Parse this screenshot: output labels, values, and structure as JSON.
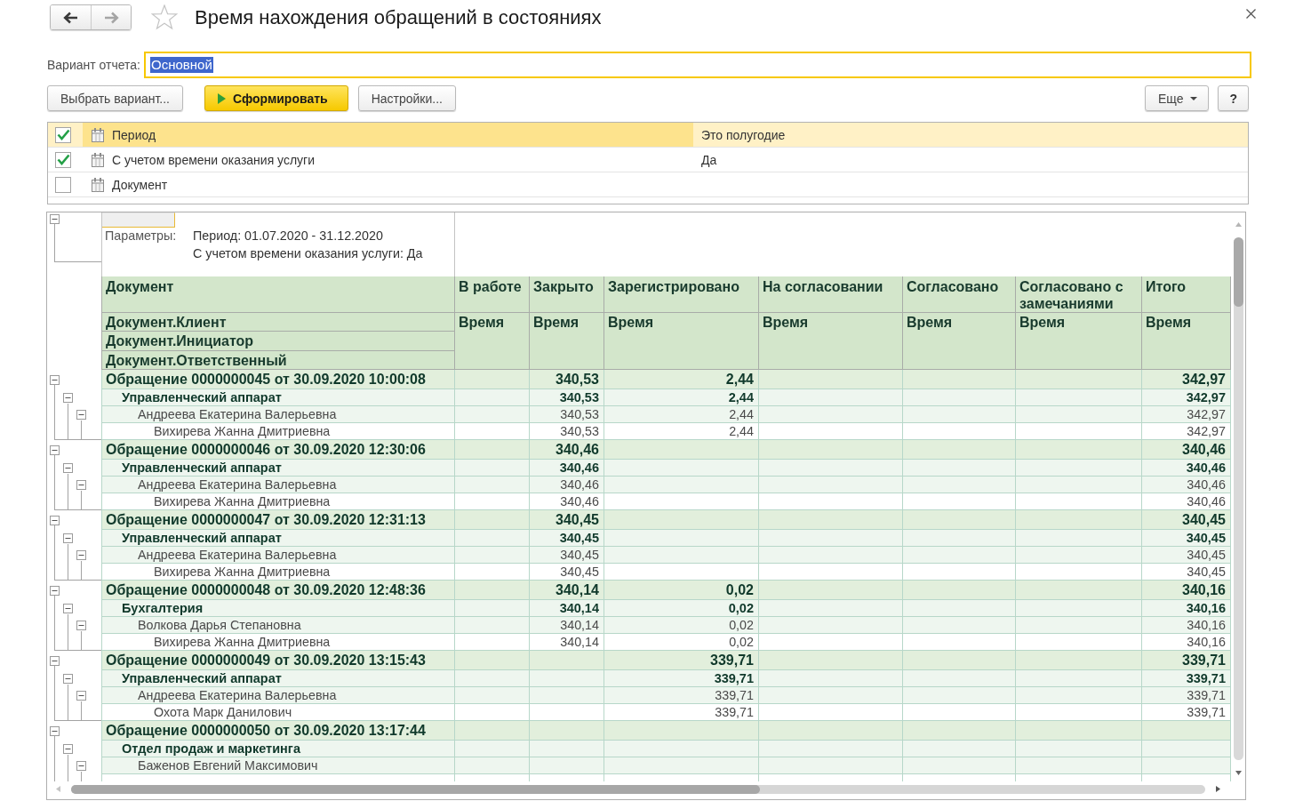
{
  "window": {
    "title": "Время нахождения обращений в состояниях",
    "favorite": false
  },
  "navigation": {
    "back": {
      "disabled": false
    },
    "forward": {
      "disabled": true
    }
  },
  "report_variant": {
    "label": "Вариант отчета:",
    "value": "Основной",
    "focused": true
  },
  "command_bar": {
    "buttons": [
      {
        "kind": "plain",
        "label": "Выбрать вариант..."
      },
      {
        "kind": "primary",
        "label": "Сформировать"
      },
      {
        "kind": "plain",
        "label": "Настройки..."
      }
    ],
    "right_buttons": [
      {
        "kind": "menu",
        "label": "Еще"
      },
      {
        "kind": "help",
        "label": "?"
      }
    ]
  },
  "settings": [
    {
      "label": "Период",
      "value": "Это полугодие",
      "checked": true,
      "selected": true
    },
    {
      "label": "С учетом времени оказания услуги",
      "value": "Да",
      "checked": true,
      "selected": false
    },
    {
      "label": "Документ",
      "checked": false,
      "selected": false
    }
  ],
  "report": {
    "header": {
      "expanded": true,
      "title_cell": {
        "selected": true
      },
      "parameters_label": "Параметры:",
      "parameters": [
        "Период: 01.07.2020 - 31.12.2020",
        "С учетом времени оказания услуги: Да"
      ]
    },
    "columns": [
      {
        "title": "Документ",
        "subtitles": [
          "Документ.Клиент",
          "Документ.Инициатор",
          "Документ.Ответственный"
        ]
      },
      {
        "title": "В работе",
        "subtitles": [
          "Время"
        ]
      },
      {
        "title": "Закрыто",
        "subtitles": [
          "Время"
        ]
      },
      {
        "title": "Зарегистрировано",
        "subtitles": [
          "Время"
        ]
      },
      {
        "title": "На согласовании",
        "subtitles": [
          "Время"
        ]
      },
      {
        "title": "Согласовано",
        "subtitles": [
          "Время"
        ]
      },
      {
        "title": "Согласовано с замечаниями",
        "subtitles": [
          "Время"
        ]
      },
      {
        "title": "Итого",
        "subtitles": [
          "Время"
        ]
      }
    ],
    "rows": [
      {
        "label": "Обращение 0000000045 от 30.09.2020 10:00:08",
        "cells": [
          {
            "kind": "blank"
          },
          {
            "kind": "number",
            "text": "340,53"
          },
          {
            "kind": "number",
            "text": "2,44"
          },
          {
            "kind": "blank"
          },
          {
            "kind": "blank"
          },
          {
            "kind": "blank"
          },
          {
            "kind": "number",
            "text": "342,97"
          }
        ],
        "expanded": true,
        "children": [
          {
            "label": "Управленческий аппарат",
            "cells": [
              {
                "kind": "blank"
              },
              {
                "kind": "number",
                "text": "340,53"
              },
              {
                "kind": "number",
                "text": "2,44"
              },
              {
                "kind": "blank"
              },
              {
                "kind": "blank"
              },
              {
                "kind": "blank"
              },
              {
                "kind": "number",
                "text": "342,97"
              }
            ],
            "expanded": true,
            "children": [
              {
                "label": "Андреева Екатерина Валерьевна",
                "cells": [
                  {
                    "kind": "blank"
                  },
                  {
                    "kind": "number",
                    "text": "340,53"
                  },
                  {
                    "kind": "number",
                    "text": "2,44"
                  },
                  {
                    "kind": "blank"
                  },
                  {
                    "kind": "blank"
                  },
                  {
                    "kind": "blank"
                  },
                  {
                    "kind": "number",
                    "text": "342,97"
                  }
                ],
                "expanded": true,
                "children": [
                  {
                    "label": "Вихирева Жанна Дмитриевна",
                    "cells": [
                      {
                        "kind": "blank"
                      },
                      {
                        "kind": "number",
                        "text": "340,53"
                      },
                      {
                        "kind": "number",
                        "text": "2,44"
                      },
                      {
                        "kind": "blank"
                      },
                      {
                        "kind": "blank"
                      },
                      {
                        "kind": "blank"
                      },
                      {
                        "kind": "number",
                        "text": "342,97"
                      }
                    ]
                  }
                ]
              }
            ]
          }
        ]
      },
      {
        "label": "Обращение 0000000046 от 30.09.2020 12:30:06",
        "cells": [
          {
            "kind": "blank"
          },
          {
            "kind": "number",
            "text": "340,46"
          },
          {
            "kind": "blank"
          },
          {
            "kind": "blank"
          },
          {
            "kind": "blank"
          },
          {
            "kind": "blank"
          },
          {
            "kind": "number",
            "text": "340,46"
          }
        ],
        "expanded": true,
        "children": [
          {
            "label": "Управленческий аппарат",
            "cells": [
              {
                "kind": "blank"
              },
              {
                "kind": "number",
                "text": "340,46"
              },
              {
                "kind": "blank"
              },
              {
                "kind": "blank"
              },
              {
                "kind": "blank"
              },
              {
                "kind": "blank"
              },
              {
                "kind": "number",
                "text": "340,46"
              }
            ],
            "expanded": true,
            "children": [
              {
                "label": "Андреева Екатерина Валерьевна",
                "cells": [
                  {
                    "kind": "blank"
                  },
                  {
                    "kind": "number",
                    "text": "340,46"
                  },
                  {
                    "kind": "blank"
                  },
                  {
                    "kind": "blank"
                  },
                  {
                    "kind": "blank"
                  },
                  {
                    "kind": "blank"
                  },
                  {
                    "kind": "number",
                    "text": "340,46"
                  }
                ],
                "expanded": true,
                "children": [
                  {
                    "label": "Вихирева Жанна Дмитриевна",
                    "cells": [
                      {
                        "kind": "blank"
                      },
                      {
                        "kind": "number",
                        "text": "340,46"
                      },
                      {
                        "kind": "blank"
                      },
                      {
                        "kind": "blank"
                      },
                      {
                        "kind": "blank"
                      },
                      {
                        "kind": "blank"
                      },
                      {
                        "kind": "number",
                        "text": "340,46"
                      }
                    ]
                  }
                ]
              }
            ]
          }
        ]
      },
      {
        "label": "Обращение 0000000047 от 30.09.2020 12:31:13",
        "cells": [
          {
            "kind": "blank"
          },
          {
            "kind": "number",
            "text": "340,45"
          },
          {
            "kind": "blank"
          },
          {
            "kind": "blank"
          },
          {
            "kind": "blank"
          },
          {
            "kind": "blank"
          },
          {
            "kind": "number",
            "text": "340,45"
          }
        ],
        "expanded": true,
        "children": [
          {
            "label": "Управленческий аппарат",
            "cells": [
              {
                "kind": "blank"
              },
              {
                "kind": "number",
                "text": "340,45"
              },
              {
                "kind": "blank"
              },
              {
                "kind": "blank"
              },
              {
                "kind": "blank"
              },
              {
                "kind": "blank"
              },
              {
                "kind": "number",
                "text": "340,45"
              }
            ],
            "expanded": true,
            "children": [
              {
                "label": "Андреева Екатерина Валерьевна",
                "cells": [
                  {
                    "kind": "blank"
                  },
                  {
                    "kind": "number",
                    "text": "340,45"
                  },
                  {
                    "kind": "blank"
                  },
                  {
                    "kind": "blank"
                  },
                  {
                    "kind": "blank"
                  },
                  {
                    "kind": "blank"
                  },
                  {
                    "kind": "number",
                    "text": "340,45"
                  }
                ],
                "expanded": true,
                "children": [
                  {
                    "label": "Вихирева Жанна Дмитриевна",
                    "cells": [
                      {
                        "kind": "blank"
                      },
                      {
                        "kind": "number",
                        "text": "340,45"
                      },
                      {
                        "kind": "blank"
                      },
                      {
                        "kind": "blank"
                      },
                      {
                        "kind": "blank"
                      },
                      {
                        "kind": "blank"
                      },
                      {
                        "kind": "number",
                        "text": "340,45"
                      }
                    ]
                  }
                ]
              }
            ]
          }
        ]
      },
      {
        "label": "Обращение 0000000048 от 30.09.2020 12:48:36",
        "cells": [
          {
            "kind": "blank"
          },
          {
            "kind": "number",
            "text": "340,14"
          },
          {
            "kind": "number",
            "text": "0,02"
          },
          {
            "kind": "blank"
          },
          {
            "kind": "blank"
          },
          {
            "kind": "blank"
          },
          {
            "kind": "number",
            "text": "340,16"
          }
        ],
        "expanded": true,
        "children": [
          {
            "label": "Бухгалтерия",
            "cells": [
              {
                "kind": "blank"
              },
              {
                "kind": "number",
                "text": "340,14"
              },
              {
                "kind": "number",
                "text": "0,02"
              },
              {
                "kind": "blank"
              },
              {
                "kind": "blank"
              },
              {
                "kind": "blank"
              },
              {
                "kind": "number",
                "text": "340,16"
              }
            ],
            "expanded": true,
            "children": [
              {
                "label": "Волкова Дарья Степановна",
                "cells": [
                  {
                    "kind": "blank"
                  },
                  {
                    "kind": "number",
                    "text": "340,14"
                  },
                  {
                    "kind": "number",
                    "text": "0,02"
                  },
                  {
                    "kind": "blank"
                  },
                  {
                    "kind": "blank"
                  },
                  {
                    "kind": "blank"
                  },
                  {
                    "kind": "number",
                    "text": "340,16"
                  }
                ],
                "expanded": true,
                "children": [
                  {
                    "label": "Вихирева Жанна Дмитриевна",
                    "cells": [
                      {
                        "kind": "blank"
                      },
                      {
                        "kind": "number",
                        "text": "340,14"
                      },
                      {
                        "kind": "number",
                        "text": "0,02"
                      },
                      {
                        "kind": "blank"
                      },
                      {
                        "kind": "blank"
                      },
                      {
                        "kind": "blank"
                      },
                      {
                        "kind": "number",
                        "text": "340,16"
                      }
                    ]
                  }
                ]
              }
            ]
          }
        ]
      },
      {
        "label": "Обращение 0000000049 от 30.09.2020 13:15:43",
        "cells": [
          {
            "kind": "blank"
          },
          {
            "kind": "blank"
          },
          {
            "kind": "number",
            "text": "339,71"
          },
          {
            "kind": "blank"
          },
          {
            "kind": "blank"
          },
          {
            "kind": "blank"
          },
          {
            "kind": "number",
            "text": "339,71"
          }
        ],
        "expanded": true,
        "children": [
          {
            "label": "Управленческий аппарат",
            "cells": [
              {
                "kind": "blank"
              },
              {
                "kind": "blank"
              },
              {
                "kind": "number",
                "text": "339,71"
              },
              {
                "kind": "blank"
              },
              {
                "kind": "blank"
              },
              {
                "kind": "blank"
              },
              {
                "kind": "number",
                "text": "339,71"
              }
            ],
            "expanded": true,
            "children": [
              {
                "label": "Андреева Екатерина Валерьевна",
                "cells": [
                  {
                    "kind": "blank"
                  },
                  {
                    "kind": "blank"
                  },
                  {
                    "kind": "number",
                    "text": "339,71"
                  },
                  {
                    "kind": "blank"
                  },
                  {
                    "kind": "blank"
                  },
                  {
                    "kind": "blank"
                  },
                  {
                    "kind": "number",
                    "text": "339,71"
                  }
                ],
                "expanded": true,
                "children": [
                  {
                    "label": "Охота Марк Данилович",
                    "cells": [
                      {
                        "kind": "blank"
                      },
                      {
                        "kind": "blank"
                      },
                      {
                        "kind": "number",
                        "text": "339,71"
                      },
                      {
                        "kind": "blank"
                      },
                      {
                        "kind": "blank"
                      },
                      {
                        "kind": "blank"
                      },
                      {
                        "kind": "number",
                        "text": "339,71"
                      }
                    ]
                  }
                ]
              }
            ]
          }
        ]
      },
      {
        "label": "Обращение 0000000050 от 30.09.2020 13:17:44",
        "expanded": true,
        "children": [
          {
            "label": "Отдел продаж и маркетинга",
            "expanded": true,
            "children": [
              {
                "label": "Баженов Евгений Максимович",
                "expanded": true
              }
            ]
          }
        ]
      }
    ]
  }
}
